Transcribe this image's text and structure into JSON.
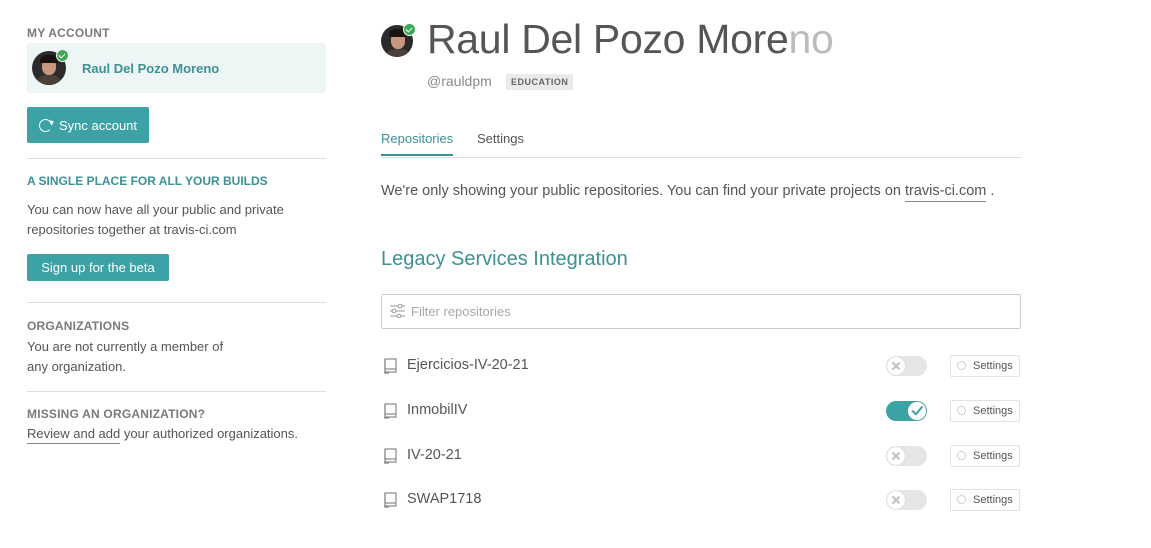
{
  "sidebar": {
    "account_title": "MY ACCOUNT",
    "account_name": "Raul Del Pozo Moreno",
    "sync_label": "Sync account",
    "beta_title": "A SINGLE PLACE FOR ALL YOUR BUILDS",
    "beta_text": "You can now have all your public and private repositories together at travis-ci.com",
    "beta_button": "Sign up for the beta",
    "org_title": "ORGANIZATIONS",
    "org_text": "You are not currently a member of any organization.",
    "missing_title": "MISSING AN ORGANIZATION?",
    "missing_link": "Review and add",
    "missing_rest": " your authorized organizations."
  },
  "profile": {
    "name_main": "Raul Del Pozo More",
    "name_faded": "no",
    "handle": "@rauldpm",
    "badge": "EDUCATION"
  },
  "tabs": [
    {
      "label": "Repositories",
      "active": true
    },
    {
      "label": "Settings",
      "active": false
    }
  ],
  "notice": {
    "text": "We're only showing your public repositories. You can find your private projects on ",
    "link": "travis-ci.com",
    "suffix": " ."
  },
  "legacy_title": "Legacy Services Integration",
  "filter": {
    "placeholder": "Filter repositories"
  },
  "repos": [
    {
      "name": "Ejercicios-IV-20-21",
      "enabled": false,
      "settings_label": "Settings"
    },
    {
      "name": "InmobilIV",
      "enabled": true,
      "settings_label": "Settings"
    },
    {
      "name": "IV-20-21",
      "enabled": false,
      "settings_label": "Settings"
    },
    {
      "name": "SWAP1718",
      "enabled": false,
      "settings_label": "Settings"
    }
  ],
  "colors": {
    "accent": "#3ba3a6",
    "accent_text": "#3a9296",
    "verified": "#39aa56"
  },
  "icons": [
    "verified-check-icon",
    "sync-icon",
    "filter-sliders-icon",
    "repo-book-icon",
    "gear-icon",
    "toggle-x-icon",
    "toggle-check-icon"
  ]
}
